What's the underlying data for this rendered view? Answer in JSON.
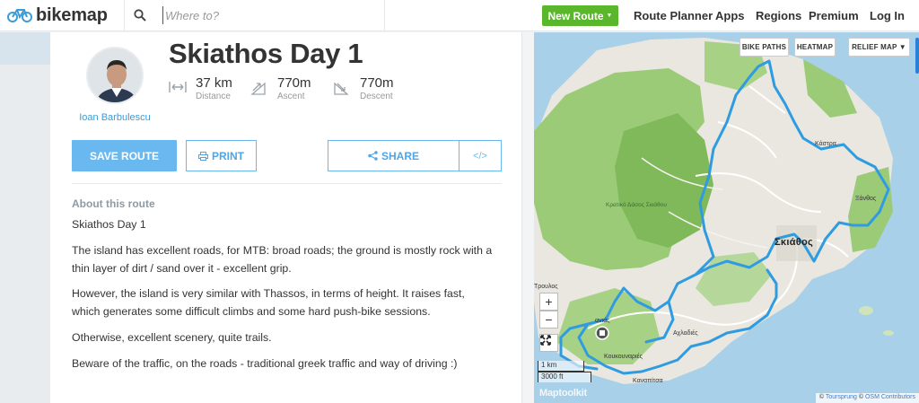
{
  "header": {
    "logo_text": "bikemap",
    "search_placeholder": "Where to?",
    "new_route_label": "New Route",
    "nav": [
      "Route Planner",
      "Apps",
      "Regions",
      "Premium",
      "Log In"
    ]
  },
  "route": {
    "author": "Ioan Barbulescu",
    "title": "Skiathos Day 1",
    "stats": [
      {
        "value": "37 km",
        "label": "Distance",
        "icon": "distance-icon"
      },
      {
        "value": "770m",
        "label": "Ascent",
        "icon": "ascent-icon"
      },
      {
        "value": "770m",
        "label": "Descent",
        "icon": "descent-icon"
      }
    ],
    "buttons": {
      "save": "SAVE ROUTE",
      "print": "PRINT",
      "share": "SHARE",
      "embed": "</>"
    },
    "about_heading": "About this route",
    "description": [
      "Skiathos Day 1",
      "The island has excellent roads, for MTB: broad roads; the ground is mostly rock with a thin layer of dirt / sand over it - excellent grip.",
      "However, the island is very similar with Thassos, in terms of height. It raises fast, which generates some difficult climbs and some hard push-bike sessions.",
      "Otherwise, excellent scenery, quite trails.",
      "Beware of the traffic, on the roads - traditional greek traffic and way of driving :)"
    ]
  },
  "map": {
    "layer_buttons": [
      "BIKE PATHS",
      "HEATMAP",
      "RELIEF MAP ▼"
    ],
    "zoom_in": "+",
    "zoom_out": "−",
    "scale_metric": "1 km",
    "scale_imperial": "3000 ft",
    "brand": "Maptoolkit",
    "attribution_prefix": "© ",
    "attribution_link1": "Toursprung",
    "attribution_mid": " © ",
    "attribution_link2": "OSM Contributors",
    "labels": {
      "forest": "Κρατικό Δάσος Σκιάθου",
      "town": "Σκιάθος",
      "kastro": "Κάστρα",
      "exanthos": "Ξάνθος",
      "achladies": "Αχλαδιές",
      "kanapitsa": "Καναπίτσα",
      "troulos": "Τρουλος",
      "koukounaries": "Κουκουναριές",
      "agia": "ανιάς"
    },
    "colors": {
      "route": "#2f9be0",
      "sea": "#a8d0e8",
      "land": "#e8e6df",
      "forest": "#8fbf6a"
    }
  }
}
